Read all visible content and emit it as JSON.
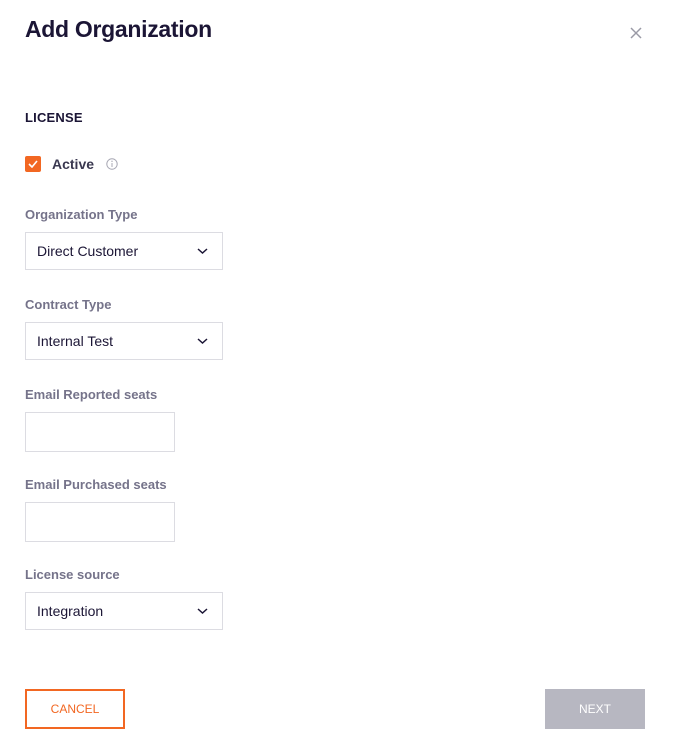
{
  "dialog": {
    "title": "Add Organization",
    "close_icon": "close-icon"
  },
  "license": {
    "heading": "LICENSE",
    "active": {
      "label": "Active",
      "checked": true,
      "icon": "info-icon"
    },
    "organization_type": {
      "label": "Organization Type",
      "value": "Direct Customer"
    },
    "contract_type": {
      "label": "Contract Type",
      "value": "Internal Test"
    },
    "email_reported_seats": {
      "label": "Email Reported seats",
      "value": ""
    },
    "email_purchased_seats": {
      "label": "Email Purchased seats",
      "value": ""
    },
    "license_source": {
      "label": "License source",
      "value": "Integration"
    }
  },
  "footer": {
    "cancel_label": "CANCEL",
    "next_label": "NEXT",
    "next_enabled": false
  },
  "colors": {
    "accent": "#f26722",
    "disabled_button": "#b7b7c1",
    "title": "#1b1535"
  }
}
